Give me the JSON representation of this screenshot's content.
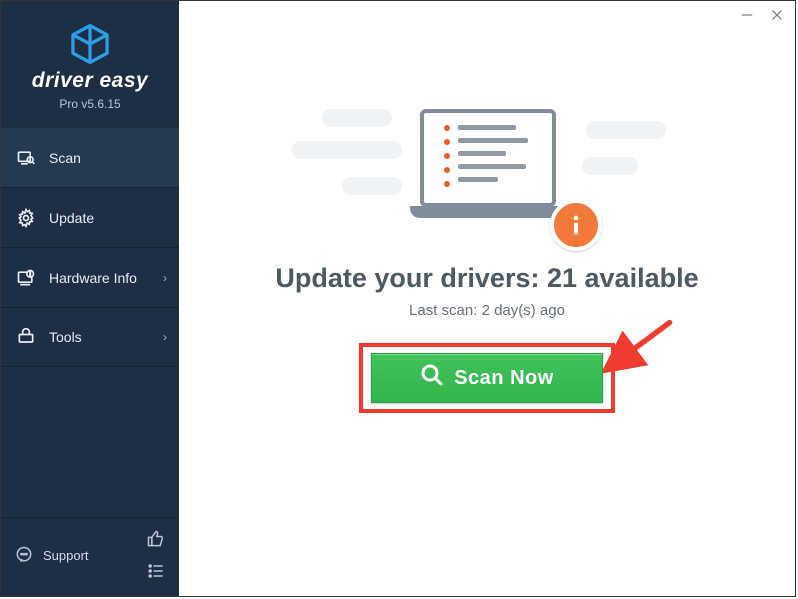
{
  "brand": {
    "name": "driver easy",
    "version_label": "Pro v5.6.15"
  },
  "sidebar": {
    "items": [
      {
        "label": "Scan"
      },
      {
        "label": "Update"
      },
      {
        "label": "Hardware Info"
      },
      {
        "label": "Tools"
      }
    ],
    "support_label": "Support"
  },
  "main": {
    "headline_prefix": "Update your drivers: ",
    "available_count": 21,
    "headline_suffix": " available",
    "last_scan_prefix": "Last scan: ",
    "last_scan_value": "2 day(s) ago",
    "scan_button_label": "Scan Now"
  },
  "colors": {
    "accent_red": "#ef3c2e",
    "accent_green": "#33b44e",
    "sidebar_bg": "#1e2e44",
    "brand_logo": "#2aa0e6",
    "badge_orange": "#f17a3a"
  }
}
